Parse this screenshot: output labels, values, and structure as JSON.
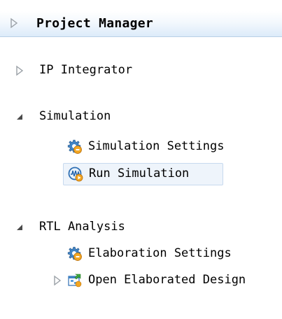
{
  "header": {
    "title": "Project Manager"
  },
  "sections": [
    {
      "label": "IP Integrator"
    },
    {
      "label": "Simulation",
      "children": [
        {
          "label": "Simulation Settings",
          "icon": "gear-icon"
        },
        {
          "label": "Run Simulation",
          "icon": "run-simulation-icon"
        }
      ]
    },
    {
      "label": "RTL Analysis",
      "children": [
        {
          "label": "Elaboration Settings",
          "icon": "gear-icon"
        },
        {
          "label": "Open Elaborated Design",
          "icon": "open-design-icon"
        }
      ]
    }
  ]
}
